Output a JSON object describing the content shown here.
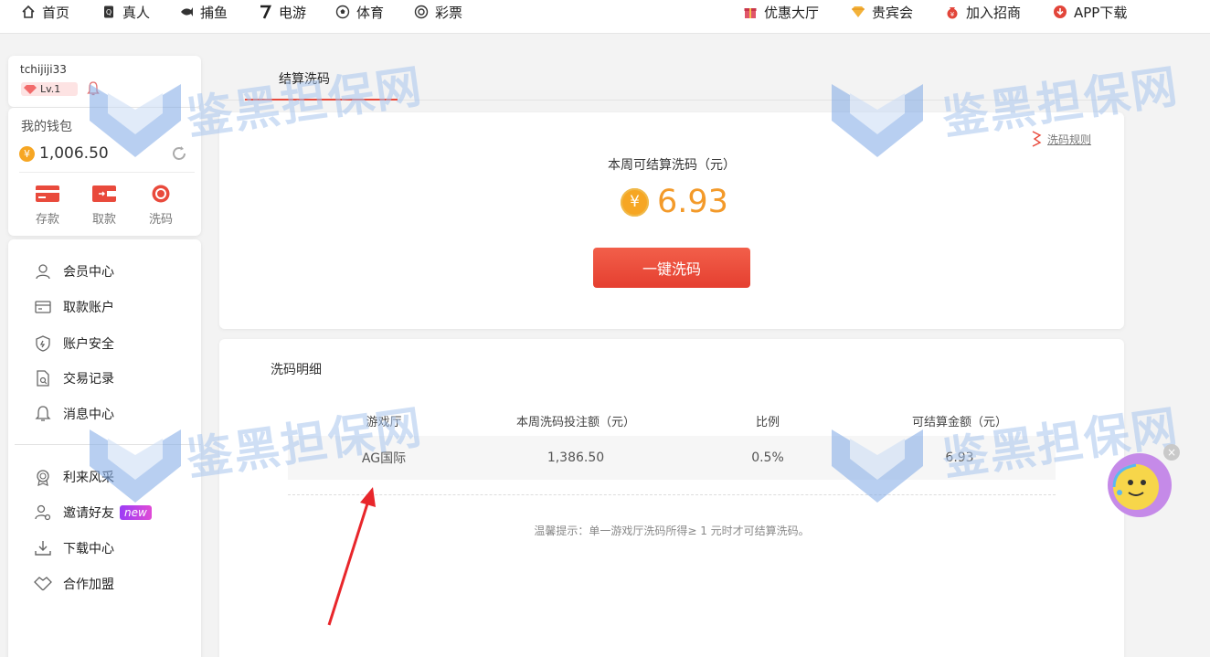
{
  "topnav": {
    "left": [
      {
        "label": "首页",
        "icon": "home-icon"
      },
      {
        "label": "真人",
        "icon": "card-icon"
      },
      {
        "label": "捕鱼",
        "icon": "fish-icon"
      },
      {
        "label": "电游",
        "icon": "slot-seven-icon"
      },
      {
        "label": "体育",
        "icon": "soccer-ball-icon"
      },
      {
        "label": "彩票",
        "icon": "lottery-ball-icon"
      }
    ],
    "right": [
      {
        "label": "优惠大厅",
        "icon": "gift-icon"
      },
      {
        "label": "贵宾会",
        "icon": "vip-diamond-icon"
      },
      {
        "label": "加入招商",
        "icon": "money-bag-icon"
      },
      {
        "label": "APP下载",
        "icon": "download-icon"
      }
    ]
  },
  "user": {
    "name": "tchijiji33",
    "level": "Lv.1"
  },
  "wallet": {
    "title": "我的钱包",
    "currency_symbol": "¥",
    "balance": "1,006.50",
    "actions": [
      {
        "label": "存款",
        "icon": "deposit-card-icon"
      },
      {
        "label": "取款",
        "icon": "withdraw-wallet-icon"
      },
      {
        "label": "洗码",
        "icon": "rebate-chip-icon"
      }
    ]
  },
  "menu": {
    "group1": [
      {
        "label": "会员中心",
        "icon": "user-icon"
      },
      {
        "label": "取款账户",
        "icon": "bank-account-icon"
      },
      {
        "label": "账户安全",
        "icon": "shield-icon"
      },
      {
        "label": "交易记录",
        "icon": "record-document-icon"
      },
      {
        "label": "消息中心",
        "icon": "bell-icon"
      }
    ],
    "group2": [
      {
        "label": "利来风采",
        "icon": "medal-icon"
      },
      {
        "label": "邀请好友",
        "icon": "invite-user-icon",
        "badge": "new"
      },
      {
        "label": "下载中心",
        "icon": "download-tray-icon"
      },
      {
        "label": "合作加盟",
        "icon": "handshake-icon"
      }
    ]
  },
  "tabs": {
    "active": "结算洗码"
  },
  "settle": {
    "rules_link": "洗码规则",
    "label": "本周可结算洗码（元）",
    "currency_symbol": "¥",
    "amount": "6.93",
    "button": "一键洗码"
  },
  "detail": {
    "title": "洗码明细",
    "columns": [
      "游戏厅",
      "本周洗码投注额（元）",
      "比例",
      "可结算金额（元）"
    ],
    "rows": [
      [
        "AG国际",
        "1,386.50",
        "0.5%",
        "6.93"
      ]
    ],
    "tip": "温馨提示：单一游戏厅洗码所得≥ 1 元时才可结算洗码。"
  },
  "watermark": {
    "text": "鉴黑担保网"
  },
  "colors": {
    "accent_red": "#e94a3c",
    "amount_orange": "#f39a2a",
    "coin_gold": "#f6a623",
    "watermark_blue": "#a9c6ee"
  },
  "mascot": {
    "close_label": "×"
  }
}
